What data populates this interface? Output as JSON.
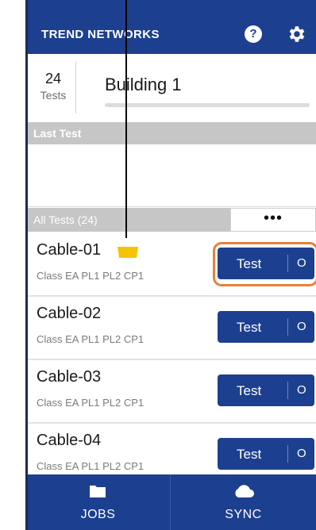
{
  "header": {
    "brand": "TREND NETWORKS"
  },
  "project": {
    "test_count": "24",
    "test_count_label": "Tests",
    "name": "Building 1",
    "progress_fraction": 0.0
  },
  "last_test": {
    "label": "Last Test"
  },
  "all_tests": {
    "label": "All Tests (24)",
    "more_label": "•••"
  },
  "rows": [
    {
      "name": "Cable-01",
      "cls": "Class EA PL1 PL2 CP1",
      "test_label": "Test",
      "alt_label": "O"
    },
    {
      "name": "Cable-02",
      "cls": "Class EA PL1 PL2 CP1",
      "test_label": "Test",
      "alt_label": "O"
    },
    {
      "name": "Cable-03",
      "cls": "Class EA PL1 PL2 CP1",
      "test_label": "Test",
      "alt_label": "O"
    },
    {
      "name": "Cable-04",
      "cls": "Class EA PL1 PL2 CP1",
      "test_label": "Test",
      "alt_label": "O"
    }
  ],
  "nav": {
    "jobs": "JOBS",
    "sync": "SYNC"
  },
  "colors": {
    "brand_blue": "#1d3f8f",
    "tag_yellow": "#f5c400",
    "highlight_orange": "#e8813a"
  }
}
